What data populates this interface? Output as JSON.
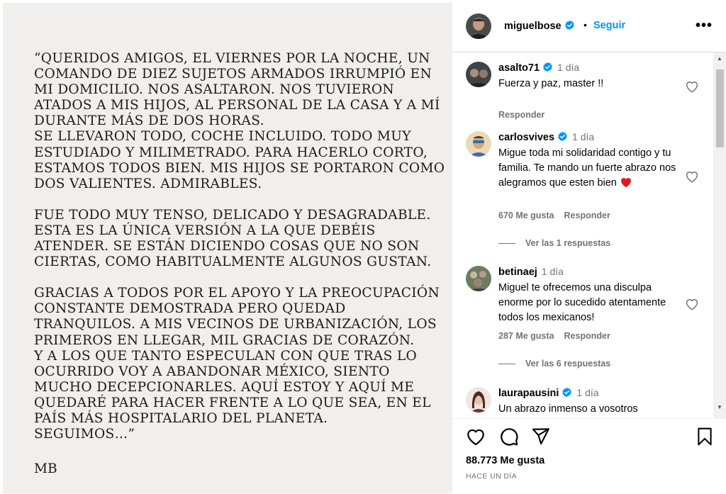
{
  "post": {
    "quote_paragraphs": [
      "“Queridos amigos, el viernes por la noche, un comando de diez sujetos armados irrumpió en mi domicilio. Nos asaltaron. Nos tuvieron atados a mis hijos, al personal de la casa y a mí durante más de dos horas.",
      "Se llevaron todo, coche incluido. Todo muy estudiado y milimetrado. Para hacerlo corto, estamos todos bien. Mis hijos se portaron como dos valientes. Admirables.",
      "Fue todo muy tenso, delicado y desagradable. Esta es la única versión a la que debéis atender. Se están diciendo cosas que no son ciertas, como habitualmente algunos gustan.",
      "Gracias a todos por el apoyo y la preocupación constante demostrada pero quedad tranquilos. A mis vecinos de urbanización, los primeros en llegar, mil gracias de corazón.",
      "Y a los que tanto especulan con que tras lo ocurrido voy a abandonar México, siento mucho decepcionarles. Aquí estoy y aquí me quedaré para hacer frente a lo que sea, en el país más hospitalario del planeta.",
      "Seguimos…”"
    ],
    "signature": "MB"
  },
  "header": {
    "username": "miguelbose",
    "separator": "•",
    "follow_label": "Seguir",
    "more_label": "•••",
    "verified_icon": "verified-badge-icon",
    "more_icon": "more-options-icon"
  },
  "comments": [
    {
      "username": "asalto71",
      "verified": true,
      "time": "1 día",
      "text": "Fuerza y paz, master !!",
      "likes": "",
      "reply_label": "Responder",
      "replies_label": ""
    },
    {
      "username": "carlosvives",
      "verified": true,
      "time": "1 día",
      "text": "Migue toda mi solidaridad contigo y tu familia. Te mando un fuerte abrazo nos alegramos que esten bien",
      "emoji": "heart-emoji",
      "likes": "670 Me gusta",
      "reply_label": "Responder",
      "replies_label": "Ver las 1 respuestas"
    },
    {
      "username": "betinaej",
      "verified": false,
      "time": "1 día",
      "text": "Miguel te ofrecemos una disculpa enorme por lo sucedido atentamente todos los mexicanos!",
      "likes": "287 Me gusta",
      "reply_label": "Responder",
      "replies_label": "Ver las 6 respuestas"
    },
    {
      "username": "laurapausini",
      "verified": true,
      "time": "1 día",
      "text": "Un abrazo inmenso a vosotros",
      "likes": "",
      "reply_label": "",
      "replies_label": ""
    }
  ],
  "footer": {
    "likes": "88.773 Me gusta",
    "posted": "HACE UN DÍA",
    "icons": [
      "like-heart-icon",
      "comment-icon",
      "share-icon",
      "save-bookmark-icon"
    ]
  },
  "colors": {
    "accent": "#0095f6",
    "verified": "#0095f6",
    "muted": "#737373",
    "post_bg": "#f0efed",
    "heart_emoji": "#e0191f"
  }
}
